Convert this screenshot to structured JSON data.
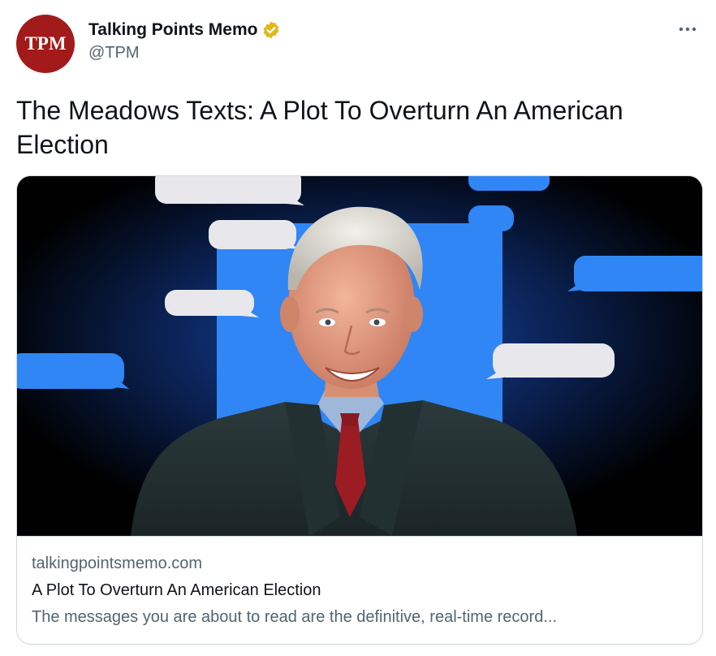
{
  "author": {
    "avatar_text": "TPM",
    "display_name": "Talking Points Memo",
    "handle": "@TPM",
    "verified_icon": "verified-badge-icon",
    "avatar_color": "#a31a1a",
    "verified_color": "#e2b719"
  },
  "more_icon": "more-options-icon",
  "tweet": {
    "text": "The Meadows Texts: A Plot To Overturn An American Election"
  },
  "card": {
    "image_icon": "article-image",
    "domain": "talkingpointsmemo.com",
    "title": "A Plot To Overturn An American Election",
    "description": "The messages you are about to read are the definitive, real-time record..."
  },
  "colors": {
    "text_primary": "#0f1419",
    "text_secondary": "#536471",
    "border": "#cfd9de",
    "bubble_blue": "#2f86f4",
    "bubble_gray": "#e8e7ec"
  }
}
